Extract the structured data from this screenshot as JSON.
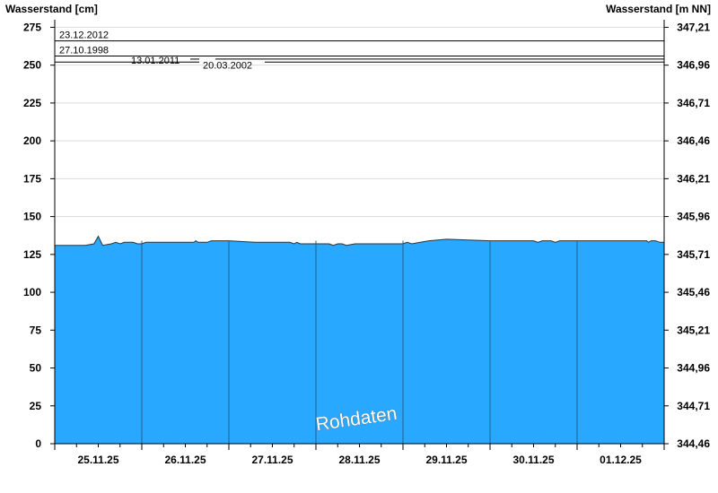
{
  "chart_data": {
    "type": "area",
    "y_left_label": "Wasserstand [cm]",
    "y_right_label": "Wasserstand [m NN]",
    "ylim": [
      0,
      280
    ],
    "y_ticks": [
      0,
      25,
      50,
      75,
      100,
      125,
      150,
      175,
      200,
      225,
      250,
      275
    ],
    "y_right_ticks": [
      "344,46",
      "344,71",
      "344,96",
      "345,21",
      "345,46",
      "345,71",
      "345,96",
      "346,21",
      "346,46",
      "346,71",
      "346,96",
      "347,21"
    ],
    "x_range_days": [
      0,
      7
    ],
    "day_labels": [
      "25.11.25",
      "26.11.25",
      "27.11.25",
      "28.11.25",
      "29.11.25",
      "30.11.25",
      "01.12.25"
    ],
    "reference_levels": [
      {
        "label": "23.12.2012",
        "value": 266
      },
      {
        "label": "27.10.1998",
        "value": 256
      },
      {
        "label": "13.01.2011",
        "value": 254
      },
      {
        "label": "20.03.2002",
        "value": 252
      }
    ],
    "series": [
      {
        "values": [
          [
            0,
            131
          ],
          [
            0.35,
            131
          ],
          [
            0.45,
            132
          ],
          [
            0.5,
            137
          ],
          [
            0.55,
            131
          ],
          [
            0.65,
            132
          ],
          [
            0.7,
            133
          ],
          [
            0.75,
            132
          ],
          [
            0.8,
            133
          ],
          [
            0.9,
            133
          ],
          [
            0.95,
            132
          ],
          [
            1.0,
            132
          ],
          [
            1.05,
            133
          ],
          [
            1.3,
            133
          ],
          [
            1.6,
            133
          ],
          [
            1.62,
            134
          ],
          [
            1.65,
            133
          ],
          [
            1.75,
            133
          ],
          [
            1.8,
            134
          ],
          [
            2.0,
            134
          ],
          [
            2.3,
            133
          ],
          [
            2.7,
            133
          ],
          [
            2.75,
            132
          ],
          [
            2.78,
            133
          ],
          [
            2.82,
            132
          ],
          [
            3.0,
            132
          ],
          [
            3.15,
            132
          ],
          [
            3.2,
            131
          ],
          [
            3.25,
            132
          ],
          [
            3.3,
            132
          ],
          [
            3.35,
            131
          ],
          [
            3.45,
            132
          ],
          [
            4.0,
            132
          ],
          [
            4.05,
            133
          ],
          [
            4.1,
            132
          ],
          [
            4.2,
            133
          ],
          [
            4.3,
            134
          ],
          [
            4.5,
            135
          ],
          [
            5.0,
            134
          ],
          [
            5.5,
            134
          ],
          [
            5.55,
            133
          ],
          [
            5.6,
            134
          ],
          [
            5.7,
            134
          ],
          [
            5.75,
            133
          ],
          [
            5.8,
            134
          ],
          [
            6.0,
            134
          ],
          [
            6.5,
            134
          ],
          [
            6.8,
            134
          ],
          [
            6.82,
            133
          ],
          [
            6.85,
            134
          ],
          [
            6.9,
            134
          ],
          [
            6.95,
            133
          ],
          [
            7.0,
            133
          ]
        ]
      }
    ],
    "watermark": "Rohdaten",
    "colors": {
      "fill": "#29a8ff",
      "grid": "#dcdcdc",
      "day_separator": "#1f5f8b",
      "outline": "#333333"
    },
    "grid": true
  }
}
